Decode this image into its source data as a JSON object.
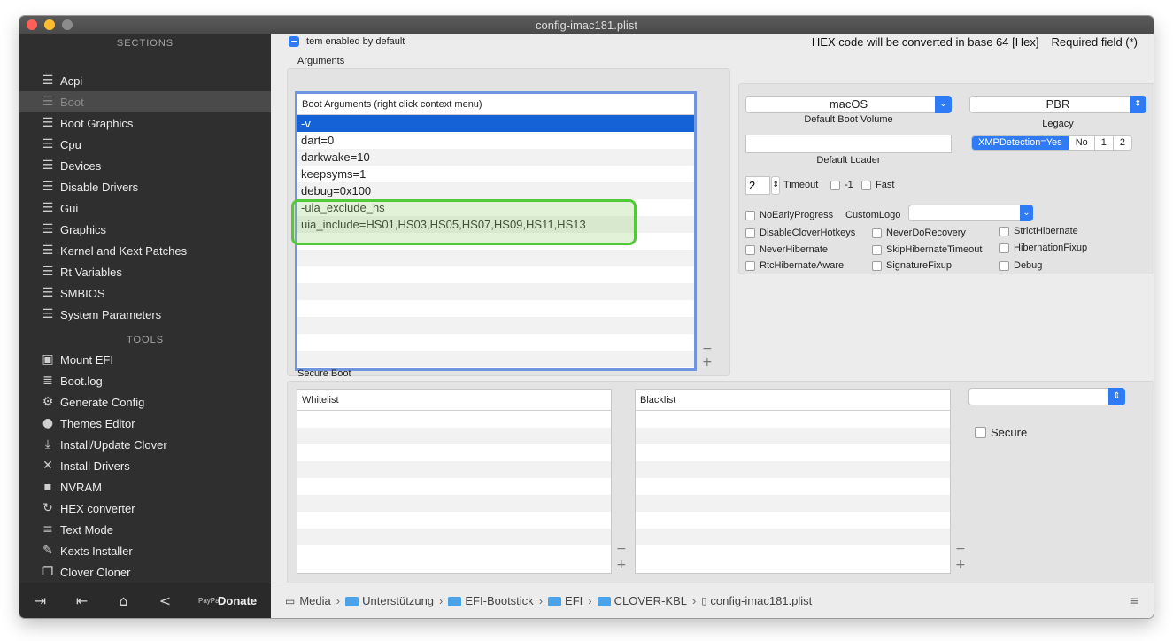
{
  "window": {
    "title": "config-imac181.plist"
  },
  "sidebar": {
    "sections_header": "SECTIONS",
    "sections": [
      {
        "label": "Acpi",
        "icon": "list-icon"
      },
      {
        "label": "Boot",
        "icon": "list-icon",
        "selected": true
      },
      {
        "label": "Boot Graphics",
        "icon": "list-icon"
      },
      {
        "label": "Cpu",
        "icon": "list-icon"
      },
      {
        "label": "Devices",
        "icon": "list-icon"
      },
      {
        "label": "Disable Drivers",
        "icon": "list-icon"
      },
      {
        "label": "Gui",
        "icon": "list-icon"
      },
      {
        "label": "Graphics",
        "icon": "list-icon"
      },
      {
        "label": "Kernel and Kext Patches",
        "icon": "list-icon"
      },
      {
        "label": "Rt Variables",
        "icon": "list-icon"
      },
      {
        "label": "SMBIOS",
        "icon": "list-icon"
      },
      {
        "label": "System Parameters",
        "icon": "list-icon"
      }
    ],
    "tools_header": "TOOLS",
    "tools": [
      {
        "label": "Mount EFI",
        "icon": "disk-icon"
      },
      {
        "label": "Boot.log",
        "icon": "log-icon"
      },
      {
        "label": "Generate Config",
        "icon": "gears-icon"
      },
      {
        "label": "Themes Editor",
        "icon": "palette-icon"
      },
      {
        "label": "Install/Update Clover",
        "icon": "download-icon"
      },
      {
        "label": "Install Drivers",
        "icon": "tools-icon"
      },
      {
        "label": "NVRAM",
        "icon": "chip-icon"
      },
      {
        "label": "HEX converter",
        "icon": "refresh-icon"
      },
      {
        "label": "Text Mode",
        "icon": "text-icon"
      },
      {
        "label": "Kexts Installer",
        "icon": "wand-icon"
      },
      {
        "label": "Clover Cloner",
        "icon": "clone-icon"
      }
    ],
    "footer": {
      "donate_label": "Donate",
      "paypal_label": "PayPal"
    }
  },
  "header": {
    "item_enabled": "Item enabled by default",
    "hex_note": "HEX code will be converted in base 64 [Hex]",
    "required_note": "Required field (*)"
  },
  "arguments": {
    "section_label": "Arguments",
    "list_header": "Boot Arguments (right click context menu)",
    "items": [
      "-v",
      "dart=0",
      "darkwake=10",
      "keepsyms=1",
      "debug=0x100",
      "-uia_exclude_hs",
      "uia_include=HS01,HS03,HS05,HS07,HS09,HS11,HS13"
    ]
  },
  "boot_options": {
    "default_volume_value": "macOS",
    "default_volume_label": "Default Boot Volume",
    "legacy_value": "PBR",
    "legacy_label": "Legacy",
    "xmp_options": [
      "XMPDetection=Yes",
      "No",
      "1",
      "2"
    ],
    "default_loader_label": "Default Loader",
    "default_loader_value": "",
    "timeout_value": "2",
    "timeout_label": "Timeout",
    "minus_one_label": "-1",
    "fast_label": "Fast",
    "no_early_progress": "NoEarlyProgress",
    "custom_logo_label": "CustomLogo",
    "flags": [
      "DisableCloverHotkeys",
      "NeverDoRecovery",
      "StrictHibernate",
      "NeverHibernate",
      "SkipHibernateTimeout",
      "HibernationFixup",
      "RtcHibernateAware",
      "SignatureFixup",
      "Debug"
    ]
  },
  "secure_boot": {
    "section_label": "Secure Boot",
    "whitelist_header": "Whitelist",
    "blacklist_header": "Blacklist",
    "secure_label": "Secure"
  },
  "pathbar": {
    "crumbs": [
      "Media",
      "Unterstützung",
      "EFI-Bootstick",
      "EFI",
      "CLOVER-KBL",
      "config-imac181.plist"
    ]
  },
  "colors": {
    "accent": "#2f7bf5",
    "sidebar_bg": "#2f2f30",
    "highlight": "#53c83a",
    "selection": "#1561d6"
  }
}
